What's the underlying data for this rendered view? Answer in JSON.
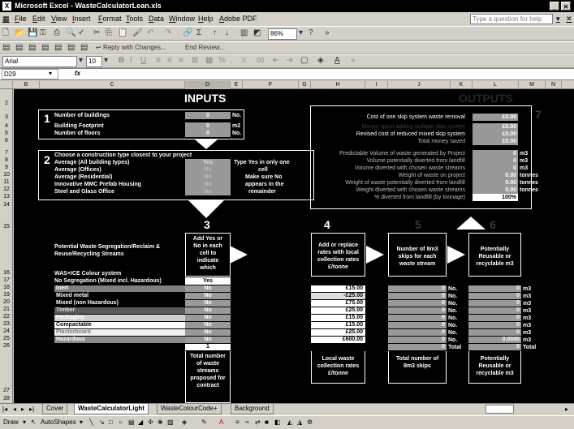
{
  "window": {
    "title": "Microsoft Excel - WasteCalculatorLean.xls",
    "min": "_",
    "close": "✕"
  },
  "menu": {
    "items": [
      "File",
      "Edit",
      "View",
      "Insert",
      "Format",
      "Tools",
      "Data",
      "Window",
      "Help",
      "Adobe PDF"
    ],
    "help_placeholder": "Type a question for help",
    "close": "✕"
  },
  "toolbar": {
    "zoom": "86%",
    "reply": "Reply with Changes...",
    "end_review": "End Review...",
    "font": "Arial",
    "size": "10"
  },
  "formula": {
    "namebox": "D29",
    "fx": "fx"
  },
  "columns": [
    "B",
    "C",
    "D",
    "E",
    "F",
    "G",
    "H",
    "I",
    "J",
    "K",
    "L",
    "M",
    "N"
  ],
  "rows": [
    "2",
    "3",
    "4",
    "5",
    "6",
    "7",
    "8",
    "9",
    "10",
    "11",
    "12",
    "13",
    "14",
    "15",
    "16",
    "17",
    "18",
    "19",
    "20",
    "21",
    "22",
    "23",
    "24",
    "25",
    "26",
    "27",
    "28"
  ],
  "inputs": {
    "heading": "INPUTS",
    "step1": "1",
    "num_buildings_label": "Number of buildings",
    "num_buildings_val": "0",
    "num_buildings_unit": "No.",
    "footprint_label": "Building Footprint",
    "footprint_val": "0",
    "footprint_unit": "m2",
    "floors_label": "Number of floors",
    "floors_val": "0",
    "floors_unit": "No.",
    "step2": "2",
    "construction_label": "Choose a construction type closest to your project",
    "types": [
      "Average (All building types)",
      "Average (Offices)",
      "Average (Residential)",
      "Innovative MMC Prefab Housing",
      "Steel and Glass Office"
    ],
    "type_values": [
      "Yes",
      "No",
      "No",
      "No",
      "No"
    ],
    "hint": [
      "Type Yes in only one",
      "cell",
      "Make sure No",
      "appears in the",
      "remainder"
    ]
  },
  "outputs": {
    "heading": "OUTPUTS",
    "step": "7",
    "rows": [
      {
        "label": "Cost of one skip system waste removal",
        "value": "£0.00",
        "unit": ""
      },
      {
        "label": "Money spent adding multiple skip system",
        "value": "£0.00",
        "unit": ""
      },
      {
        "label": "Revised cost of reduced mixed skip system",
        "value": "£0.00",
        "unit": ""
      },
      {
        "label": "Total money saved",
        "value": "£0.00",
        "unit": ""
      },
      {
        "label": "Predictable Volume of waste generated by Project",
        "value": "0",
        "unit": "m3"
      },
      {
        "label": "Volume potentially diverted from landfill",
        "value": "0",
        "unit": "m3"
      },
      {
        "label": "Volume diverted with chosen waste streams",
        "value": "0",
        "unit": "m3"
      },
      {
        "label": "Weight of waste on project",
        "value": "0.00",
        "unit": "tonnes"
      },
      {
        "label": "Weight of waste potentially diverted from landfill",
        "value": "0.00",
        "unit": "tonnes"
      },
      {
        "label": "Weight diverted with chosen waste streams",
        "value": "0.00",
        "unit": "tonnes"
      },
      {
        "label": "% diverted from landfill (by tonnage)",
        "value": "100%",
        "unit": ""
      }
    ]
  },
  "segregation": {
    "title": [
      "Potential Waste Segregation/Reclaim &",
      "Reuse/Recycling Streams"
    ],
    "colour_system": "WAS+ICE Colour system",
    "no_seg": "No Segregation (Mixed incl. Hazardous)",
    "no_seg_val": "Yes",
    "streams": [
      {
        "name": "Inert",
        "bg": "#808080",
        "fg": "#ffffff",
        "sel": "No",
        "rate": "£15.00",
        "skips": "0",
        "reuse": "0"
      },
      {
        "name": "Mixed metal",
        "bg": "#000000",
        "fg": "#ffffff",
        "sel": "No",
        "rate": "-£25.00",
        "skips": "0",
        "reuse": "0"
      },
      {
        "name": "Mixed (non Hazardous)",
        "bg": "#000000",
        "fg": "#ffffff",
        "sel": "No",
        "rate": "£75.00",
        "skips": "0",
        "reuse": "0"
      },
      {
        "name": "Timber",
        "bg": "#5a5a5a",
        "fg": "#dcdcdc",
        "sel": "No",
        "rate": "£25.00",
        "skips": "0",
        "reuse": "0"
      },
      {
        "name": "Packaging",
        "bg": "#cfcfcf",
        "fg": "#ffffff",
        "sel": "No",
        "rate": "£15.00",
        "skips": "0",
        "reuse": "0"
      },
      {
        "name": "Compactable",
        "bg": "#ffffff",
        "fg": "#000000",
        "sel": "No",
        "rate": "£15.00",
        "skips": "0",
        "reuse": "0"
      },
      {
        "name": "Plasterboard",
        "bg": "#f0f0f0",
        "fg": "#7a7a7a",
        "sel": "No",
        "rate": "£25.00",
        "skips": "0",
        "reuse": "0"
      },
      {
        "name": "Hazardous",
        "bg": "#8c8c8c",
        "fg": "#ffffff",
        "sel": "No",
        "rate": "£600.00",
        "skips": "0",
        "reuse": "0.0000"
      }
    ],
    "no_label": "No.",
    "m3_label": "m3",
    "totals": {
      "sel": "1",
      "skips": "0",
      "skips_label": "Total",
      "reuse": "0",
      "reuse_label": "Total"
    },
    "step3": "3",
    "step4": "4",
    "step5": "5",
    "step6": "6",
    "col3_head": [
      "Add Yes or",
      "No in each",
      "cell to",
      "indicate",
      "which"
    ],
    "col4_head": [
      "Add or replace",
      "rates with local",
      "collection rates",
      "£/tonne"
    ],
    "col5_head": [
      "Number of 8m3",
      "skips for each",
      "waste stream"
    ],
    "col6_head": [
      "Potentially",
      "Reusable or",
      "recyclable m3"
    ],
    "col3_foot": [
      "Total number",
      "of waste",
      "streams",
      "proposed for",
      "contract"
    ],
    "col4_foot": [
      "Local waste",
      "collection rates",
      "£/tonne"
    ],
    "col5_foot": [
      "Total number of",
      "8m3 skips"
    ],
    "col6_foot": [
      "Potentially",
      "Reusable or",
      "recyclable m3"
    ]
  },
  "tabs": [
    "Cover",
    "WasteCalculatorLight",
    "WasteColourCode+",
    "Background"
  ],
  "draw": {
    "draw": "Draw",
    "autoshapes": "AutoShapes"
  },
  "colors": {
    "sheet_bg": "#000000",
    "grey_cell": "#999999",
    "ui_bg": "#d4d0c8"
  }
}
